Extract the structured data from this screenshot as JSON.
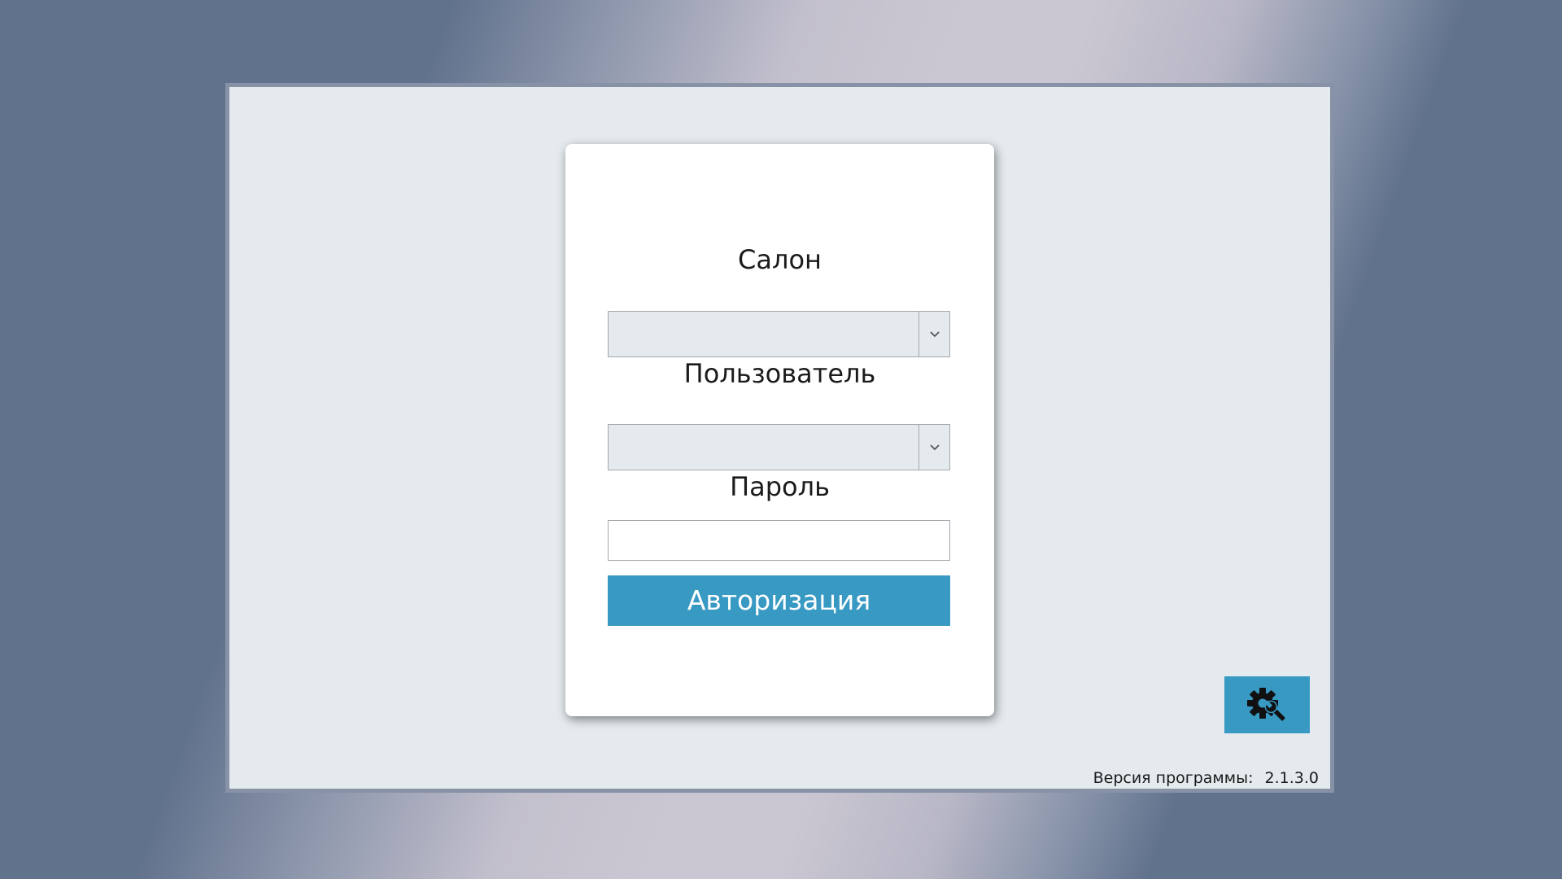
{
  "login": {
    "salon_label": "Салон",
    "salon_value": "",
    "user_label": "Пользователь",
    "user_value": "",
    "password_label": "Пароль",
    "password_value": "",
    "submit_label": "Авторизация"
  },
  "footer": {
    "version_label": "Версия программы:",
    "version_value": "2.1.3.0"
  },
  "icons": {
    "dropdown": "chevron-down-icon",
    "settings": "gear-wrench-icon"
  },
  "colors": {
    "accent": "#3899c3",
    "window_bg": "#e4eaed",
    "card_bg": "#ffffff",
    "window_border": "#8892a6"
  }
}
